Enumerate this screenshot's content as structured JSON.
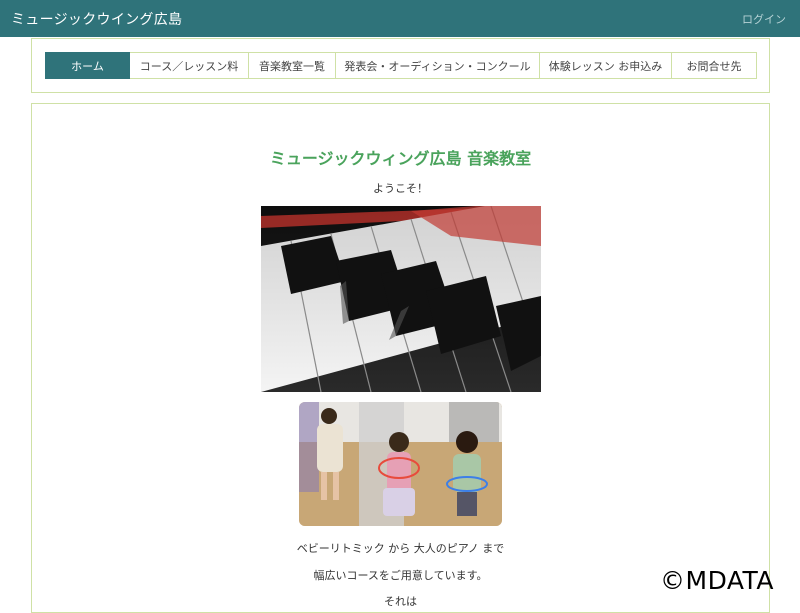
{
  "header": {
    "title": "ミュージックウイング広島",
    "login": "ログイン"
  },
  "nav": {
    "tabs": [
      {
        "label": "ホーム",
        "active": true
      },
      {
        "label": "コース／レッスン料"
      },
      {
        "label": "音楽教室一覧"
      },
      {
        "label": "発表会・オーディション・コンクール"
      },
      {
        "label": "体験レッスン お申込み"
      },
      {
        "label": "お問合せ先"
      }
    ]
  },
  "main": {
    "title": "ミュージックウィング広島 音楽教室",
    "welcome": "ようこそ！",
    "lines": [
      "ベビーリトミック から 大人のピアノ まで",
      "幅広いコースをご用意しています。",
      "それは"
    ]
  },
  "watermark": "©MDATA",
  "colors": {
    "header": "#2f737a",
    "accent_green": "#4aa35c",
    "border": "#cfe1a6"
  }
}
